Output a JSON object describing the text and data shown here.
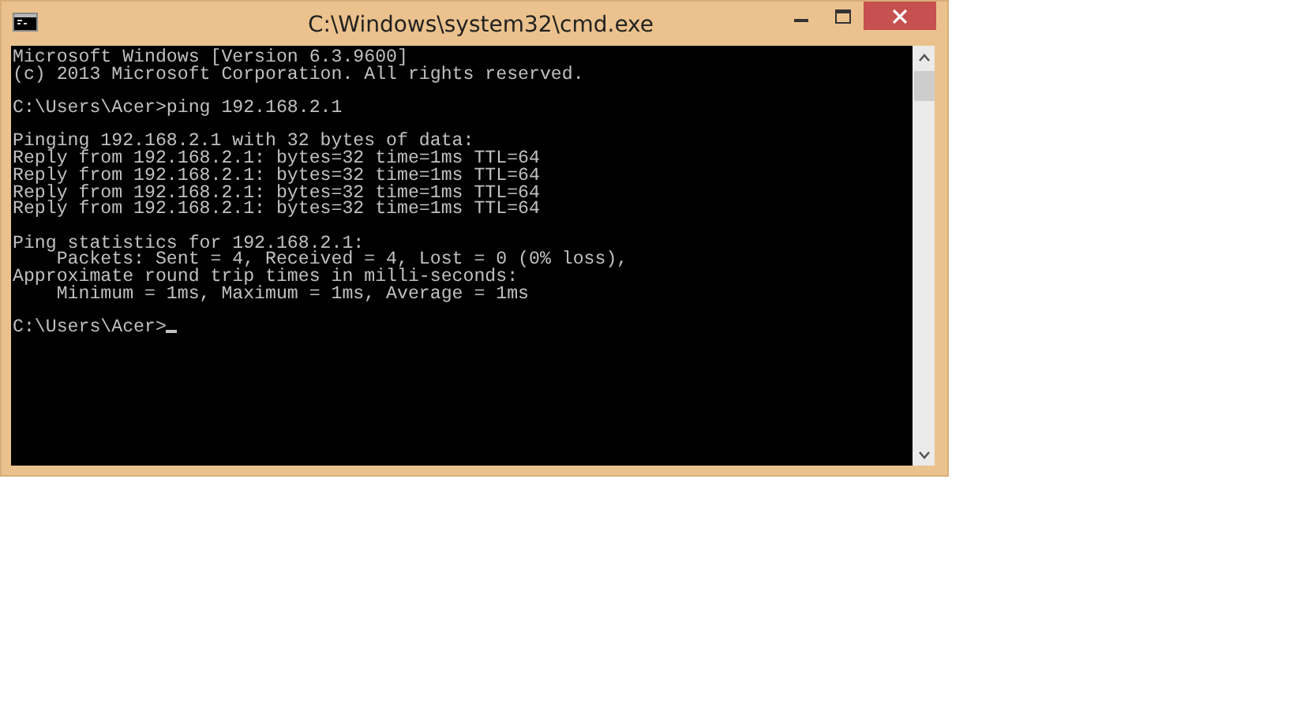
{
  "window": {
    "title": "C:\\Windows\\system32\\cmd.exe"
  },
  "console": {
    "blocks": [
      [
        "Microsoft Windows [Version 6.3.9600]",
        "(c) 2013 Microsoft Corporation. All rights reserved."
      ],
      [
        "C:\\Users\\Acer>ping 192.168.2.1"
      ],
      [
        "Pinging 192.168.2.1 with 32 bytes of data:",
        "Reply from 192.168.2.1: bytes=32 time=1ms TTL=64",
        "Reply from 192.168.2.1: bytes=32 time=1ms TTL=64",
        "Reply from 192.168.2.1: bytes=32 time=1ms TTL=64",
        "Reply from 192.168.2.1: bytes=32 time=1ms TTL=64"
      ],
      [
        "Ping statistics for 192.168.2.1:",
        "    Packets: Sent = 4, Received = 4, Lost = 0 (0% loss),",
        "Approximate round trip times in milli-seconds:",
        "    Minimum = 1ms, Maximum = 1ms, Average = 1ms"
      ],
      [
        "C:\\Users\\Acer>"
      ]
    ]
  }
}
